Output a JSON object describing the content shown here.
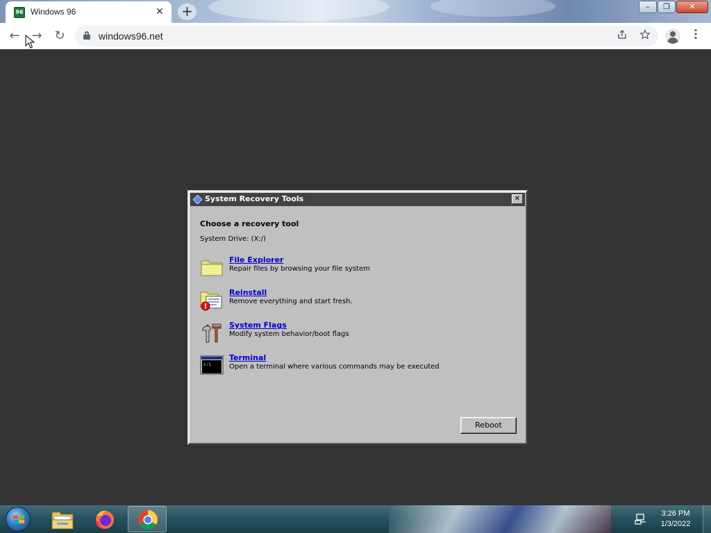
{
  "browser": {
    "tab_title": "Windows 96",
    "tab_close": "✕",
    "new_tab": "+",
    "url": "windows96.net",
    "window_controls": {
      "minimize": "–",
      "maximize": "❐",
      "close": "✕"
    },
    "nav": {
      "back": "←",
      "forward": "→",
      "reload": "↻"
    },
    "toolbar_icons": [
      "share-icon",
      "star-icon",
      "profile-icon",
      "menu-icon"
    ]
  },
  "dialog": {
    "title": "System Recovery Tools",
    "close": "✕",
    "heading": "Choose a recovery tool",
    "drive": "System Drive: (X:/)",
    "tools": [
      {
        "name": "File Explorer",
        "description": "Repair files by browsing your file system",
        "icon": "folder-icon"
      },
      {
        "name": "Reinstall",
        "description": "Remove everything and start fresh.",
        "icon": "reinstall-icon"
      },
      {
        "name": "System Flags",
        "description": "Modify system behavior/boot flags",
        "icon": "tools-icon"
      },
      {
        "name": "Terminal",
        "description": "Open a terminal where various commands may be executed",
        "icon": "terminal-icon"
      }
    ],
    "reboot": "Reboot"
  },
  "taskbar": {
    "pinned": [
      "file-explorer-icon",
      "firefox-icon",
      "chrome-icon"
    ],
    "active": "chrome-icon",
    "time": "3:26 PM",
    "date": "1/3/2022"
  },
  "colors": {
    "page_bg": "#333333",
    "dialog_bg": "#c0c0c0",
    "dialog_title_bg": "#424242",
    "link": "#0000cc"
  }
}
